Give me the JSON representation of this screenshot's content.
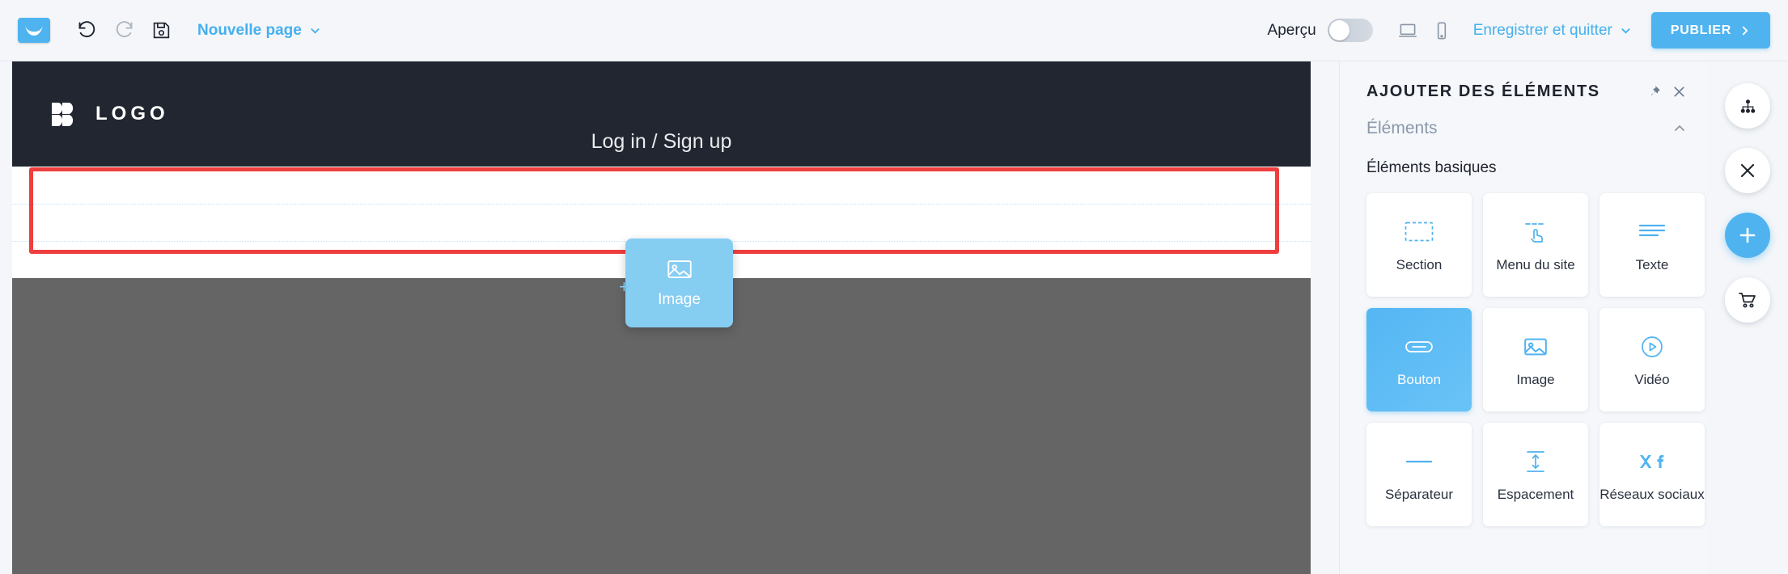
{
  "toolbar": {
    "app_logo_icon": "envelope-logo-icon",
    "undo_icon": "undo-icon",
    "redo_icon": "redo-icon",
    "save_icon": "floppy-save-icon",
    "page_name": "Nouvelle page",
    "page_chevron_icon": "chevron-down-icon",
    "preview_label": "Aperçu",
    "preview_toggle_state": "off",
    "desktop_icon": "desktop-monitor-icon",
    "mobile_icon": "mobile-phone-icon",
    "save_quit_label": "Enregistrer et quitter",
    "save_quit_chevron_icon": "chevron-down-icon",
    "publish_label": "PUBLIER",
    "publish_chevron_icon": "chevron-right-icon",
    "accent_color": "#4fb3f0"
  },
  "canvas": {
    "brand_logo_icon": "bb-double-b-logo-icon",
    "brand_text": "LOGO",
    "login_text": "Log in / Sign up",
    "header_bg": "#212630",
    "body_bg": "#656565",
    "highlight_color": "#ef3e3e"
  },
  "drag_ghost": {
    "label": "Image",
    "icon": "image-picture-icon",
    "plus_icon": "plus-small-icon",
    "color": "#86cdf2"
  },
  "panel": {
    "title": "AJOUTER DES ÉLÉMENTS",
    "pin_icon": "pin-icon",
    "close_icon": "close-x-icon",
    "section_label": "Éléments",
    "section_chevron_icon": "chevron-up-icon",
    "group_label": "Éléments basiques",
    "items": [
      {
        "label": "Section",
        "icon": "dashed-rectangle-icon",
        "active": false
      },
      {
        "label": "Menu du site",
        "icon": "pointer-hand-menu-icon",
        "active": false
      },
      {
        "label": "Texte",
        "icon": "text-lines-icon",
        "active": false
      },
      {
        "label": "Bouton",
        "icon": "button-pill-icon",
        "active": true
      },
      {
        "label": "Image",
        "icon": "image-picture-icon",
        "active": false
      },
      {
        "label": "Vidéo",
        "icon": "play-circle-icon",
        "active": false
      },
      {
        "label": "Séparateur",
        "icon": "horizontal-rule-icon",
        "active": false
      },
      {
        "label": "Espacement",
        "icon": "vertical-arrows-icon",
        "active": false
      },
      {
        "label": "Réseaux sociaux",
        "icon": "social-x-facebook-icon",
        "active": false
      }
    ]
  },
  "rail": {
    "buttons": [
      {
        "icon": "sitemap-hierarchy-icon",
        "style": "white"
      },
      {
        "icon": "close-x-icon",
        "style": "white"
      },
      {
        "icon": "plus-icon",
        "style": "blue"
      },
      {
        "icon": "shopping-cart-icon",
        "style": "white"
      }
    ]
  }
}
